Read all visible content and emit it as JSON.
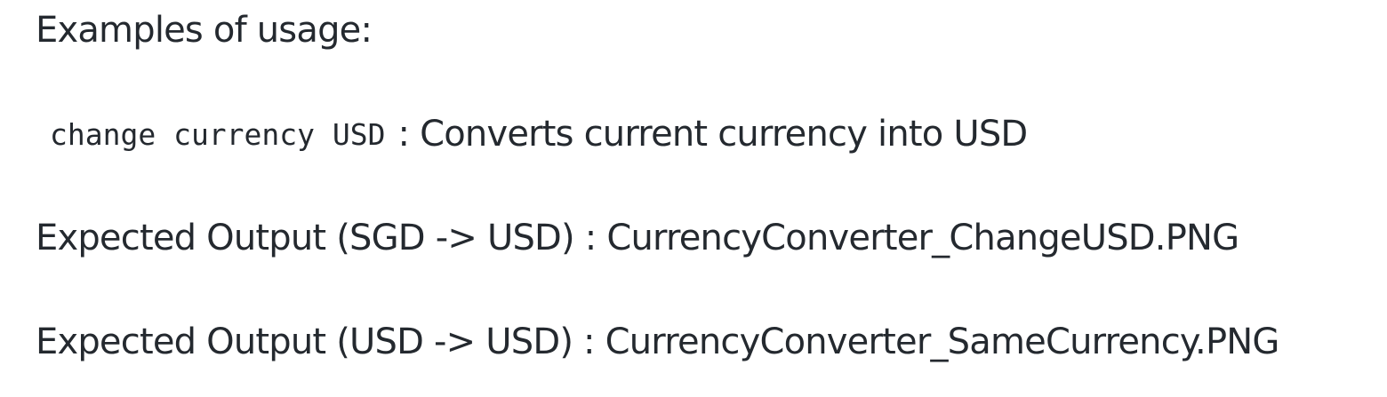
{
  "content": {
    "heading": "Examples of usage:",
    "command": {
      "code": "change currency USD",
      "description": ": Converts current currency into USD"
    },
    "outputs": [
      {
        "text": "Expected Output (SGD -> USD) : CurrencyConverter_ChangeUSD.PNG"
      },
      {
        "text": "Expected Output (USD -> USD) : CurrencyConverter_SameCurrency.PNG"
      }
    ]
  }
}
